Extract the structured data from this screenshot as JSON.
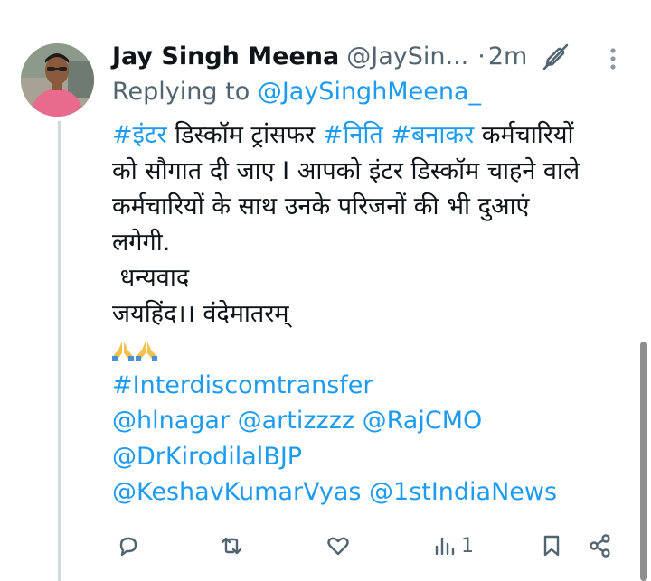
{
  "tweet": {
    "author_name": "Jay Singh Meena",
    "author_handle": "@JaySin...",
    "dot": "·",
    "timestamp": "2m",
    "replying_prefix": "Replying to",
    "replying_to": "@JaySinghMeena_",
    "body": {
      "line1": {
        "tag1": "#इंटर",
        "text1": " डिस्कॉम ट्रांसफर ",
        "tag2": "#निति",
        "space": " ",
        "tag3": "#बनाकर",
        "text2": " कर्मचारियों"
      },
      "line2": "को सौगात दी जाए I आपको इंटर डिस्कॉम चाहने वाले",
      "line3": "कर्मचारियों के साथ उनके परिजनों की भी दुआएं",
      "line4": "लगेगी.",
      "line5": " धन्यवाद",
      "line6": "जयहिंद।। वंदेमातरम्",
      "hashtag": "#Interdiscomtransfer",
      "mentions_line1": "@hlnagar @artizzzz @RajCMO",
      "mentions_line2": "@DrKirodilalBJP",
      "mentions_line3": "@KeshavKumarVyas @1stIndiaNews"
    },
    "emojis": [
      "folded-hands-icon",
      "folded-hands-icon"
    ],
    "views_count": "1"
  },
  "icons": {
    "edit": "edit-pencil-off-icon",
    "more": "more-vertical-icon",
    "reply": "reply-icon",
    "retweet": "retweet-icon",
    "like": "like-heart-icon",
    "views": "views-analytics-icon",
    "bookmark": "bookmark-icon",
    "share": "share-icon"
  },
  "colors": {
    "link": "#1d9bf0",
    "secondary_text": "#536471",
    "primary_text": "#0f1419",
    "thread_line": "#cfd9de"
  }
}
